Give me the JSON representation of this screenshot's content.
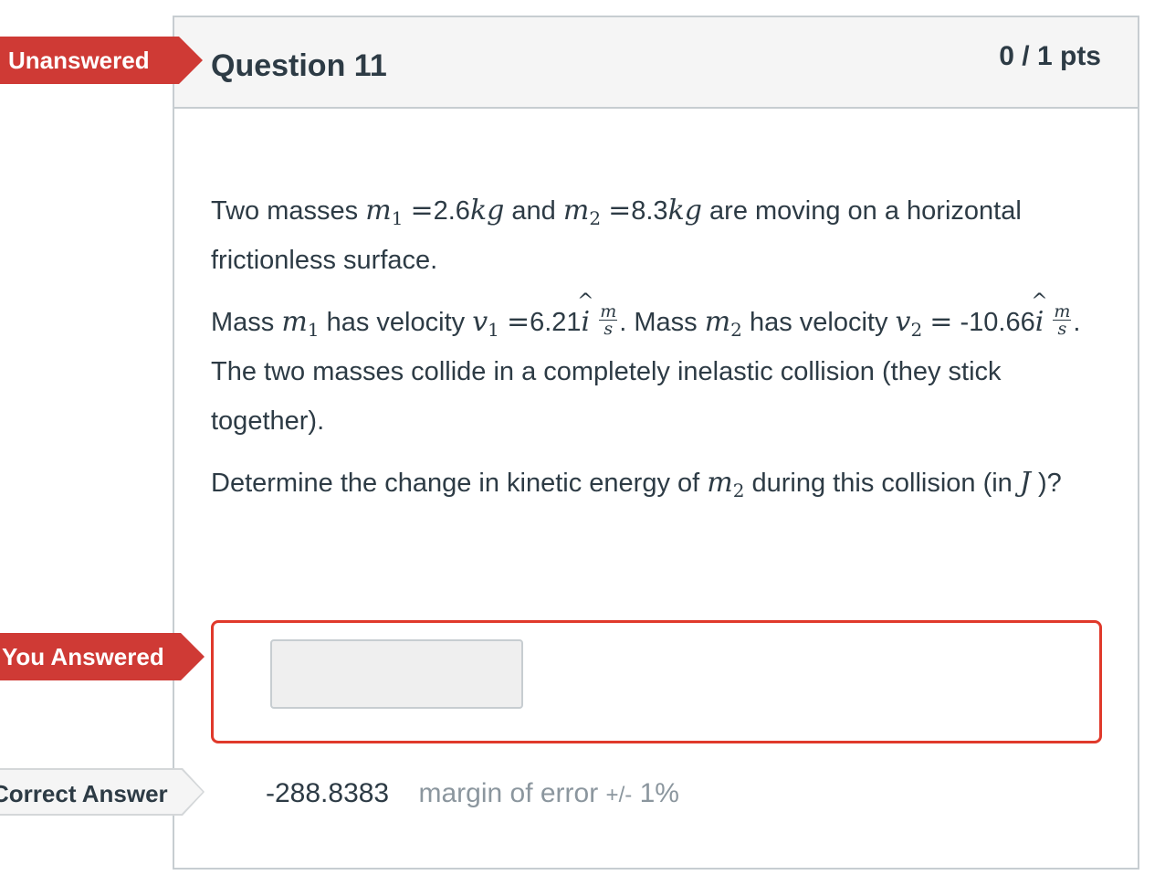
{
  "tags": {
    "unanswered": "Unanswered",
    "you_answered": "You Answered",
    "correct_answer": "Correct Answer"
  },
  "question": {
    "title": "Question 11",
    "points": "0 / 1 pts"
  },
  "body": {
    "p1_a": "Two masses",
    "m": "m",
    "sub1": "1",
    "sub2": "2",
    "eq": "=",
    "m1_value": "2.6",
    "kg": "kg",
    "and": "and",
    "m2_value": "8.3",
    "p1_b": "are moving on a horizontal frictionless surface.",
    "mass": "Mass",
    "has_velocity": "has velocity",
    "v": "v",
    "v1_value": "6.21",
    "i": "i",
    "unit_top": "m",
    "unit_bot": "s",
    "period_mass": ". Mass",
    "v2_value": "-10.66",
    "p2_b": ". The two masses collide in a completely inelastic collision (they stick together).",
    "p3_a": "Determine  the change in kinetic energy of",
    "p3_b": "during this  collision (in",
    "J": "J",
    "p3_c": ")?"
  },
  "answer": {
    "input_value": ""
  },
  "correct": {
    "value": "-288.8383",
    "margin_label": "margin of error",
    "margin_pm": "+/-",
    "margin_value": "1%"
  },
  "colors": {
    "red_tag": "#cf3a35",
    "answer_border": "#e0392b",
    "header_bg": "#f5f5f5",
    "text": "#2d3b45",
    "muted": "#8b969e"
  }
}
